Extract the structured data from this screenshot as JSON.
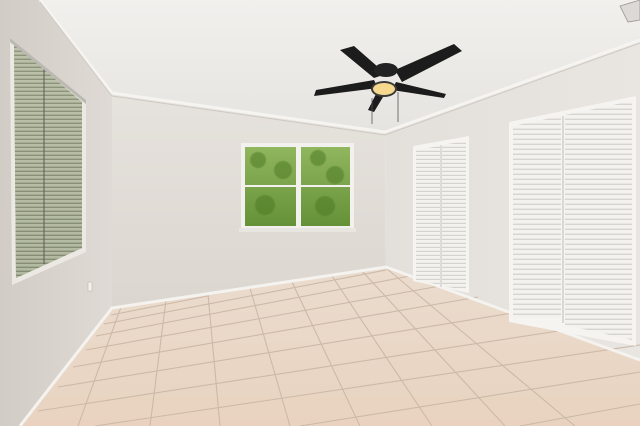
{
  "scene": {
    "colors": {
      "ceiling": "#ecebe8",
      "wall_back": "#e2ddd8",
      "wall_left": "#d9d4cf",
      "wall_right": "#e0dbd6",
      "floor_tile": "#e8d6c6",
      "grout": "#cdb9a8",
      "trim": "#f4f2ee",
      "foliage": "#6f9a3f",
      "sky": "#d8e6c2",
      "louver_door": "#f3f2ef",
      "fan_blade": "#1c1c1c",
      "fan_light": "#f6d98f"
    },
    "icons": {
      "fan": "ceiling-fan-icon",
      "window_left": "blinds-window-icon",
      "window_back": "double-window-icon",
      "closet_small": "bifold-closet-door-icon",
      "closet_large": "bifold-closet-door-icon",
      "outlet": "wall-outlet-icon",
      "vent": "ceiling-vent-icon"
    }
  }
}
